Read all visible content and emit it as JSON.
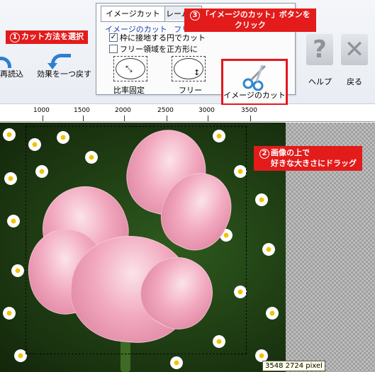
{
  "toolbar": {
    "reload_label": "再読込",
    "undo_label": "効果を一つ戻す",
    "help_label": "ヘルプ",
    "back_label": "戻る",
    "help_icon_glyph": "?",
    "back_icon_glyph": "✕"
  },
  "panel": {
    "tabs": [
      "イメージカット",
      "フレーム、"
    ],
    "group_title": "イメージのカット",
    "group_title_extra": "フリー",
    "checkbox_circle": {
      "label": "枠に接地する円でカット",
      "checked": true
    },
    "checkbox_square": {
      "label": "フリー領域を正方形に",
      "checked": false
    },
    "mode_ratio_label": "比率固定",
    "mode_free_label": "フリー",
    "cut_button_label": "イメージのカット"
  },
  "callouts": {
    "step1": {
      "num": "1",
      "text": "カット方法を選択"
    },
    "step2": {
      "num": "2",
      "line1": "画像の上で",
      "line2": "好きな大きさにドラッグ"
    },
    "step3": {
      "num": "3",
      "line1": "「イメージのカット」ボタンを",
      "line2": "クリック"
    }
  },
  "ruler": {
    "labels": [
      "1000",
      "1500",
      "2000",
      "2500",
      "3000",
      "3500"
    ]
  },
  "status": {
    "size_text": "3548 2724 pixel"
  },
  "colors": {
    "callout_red": "#e31b1b",
    "accent_blue": "#2d7fd3"
  }
}
